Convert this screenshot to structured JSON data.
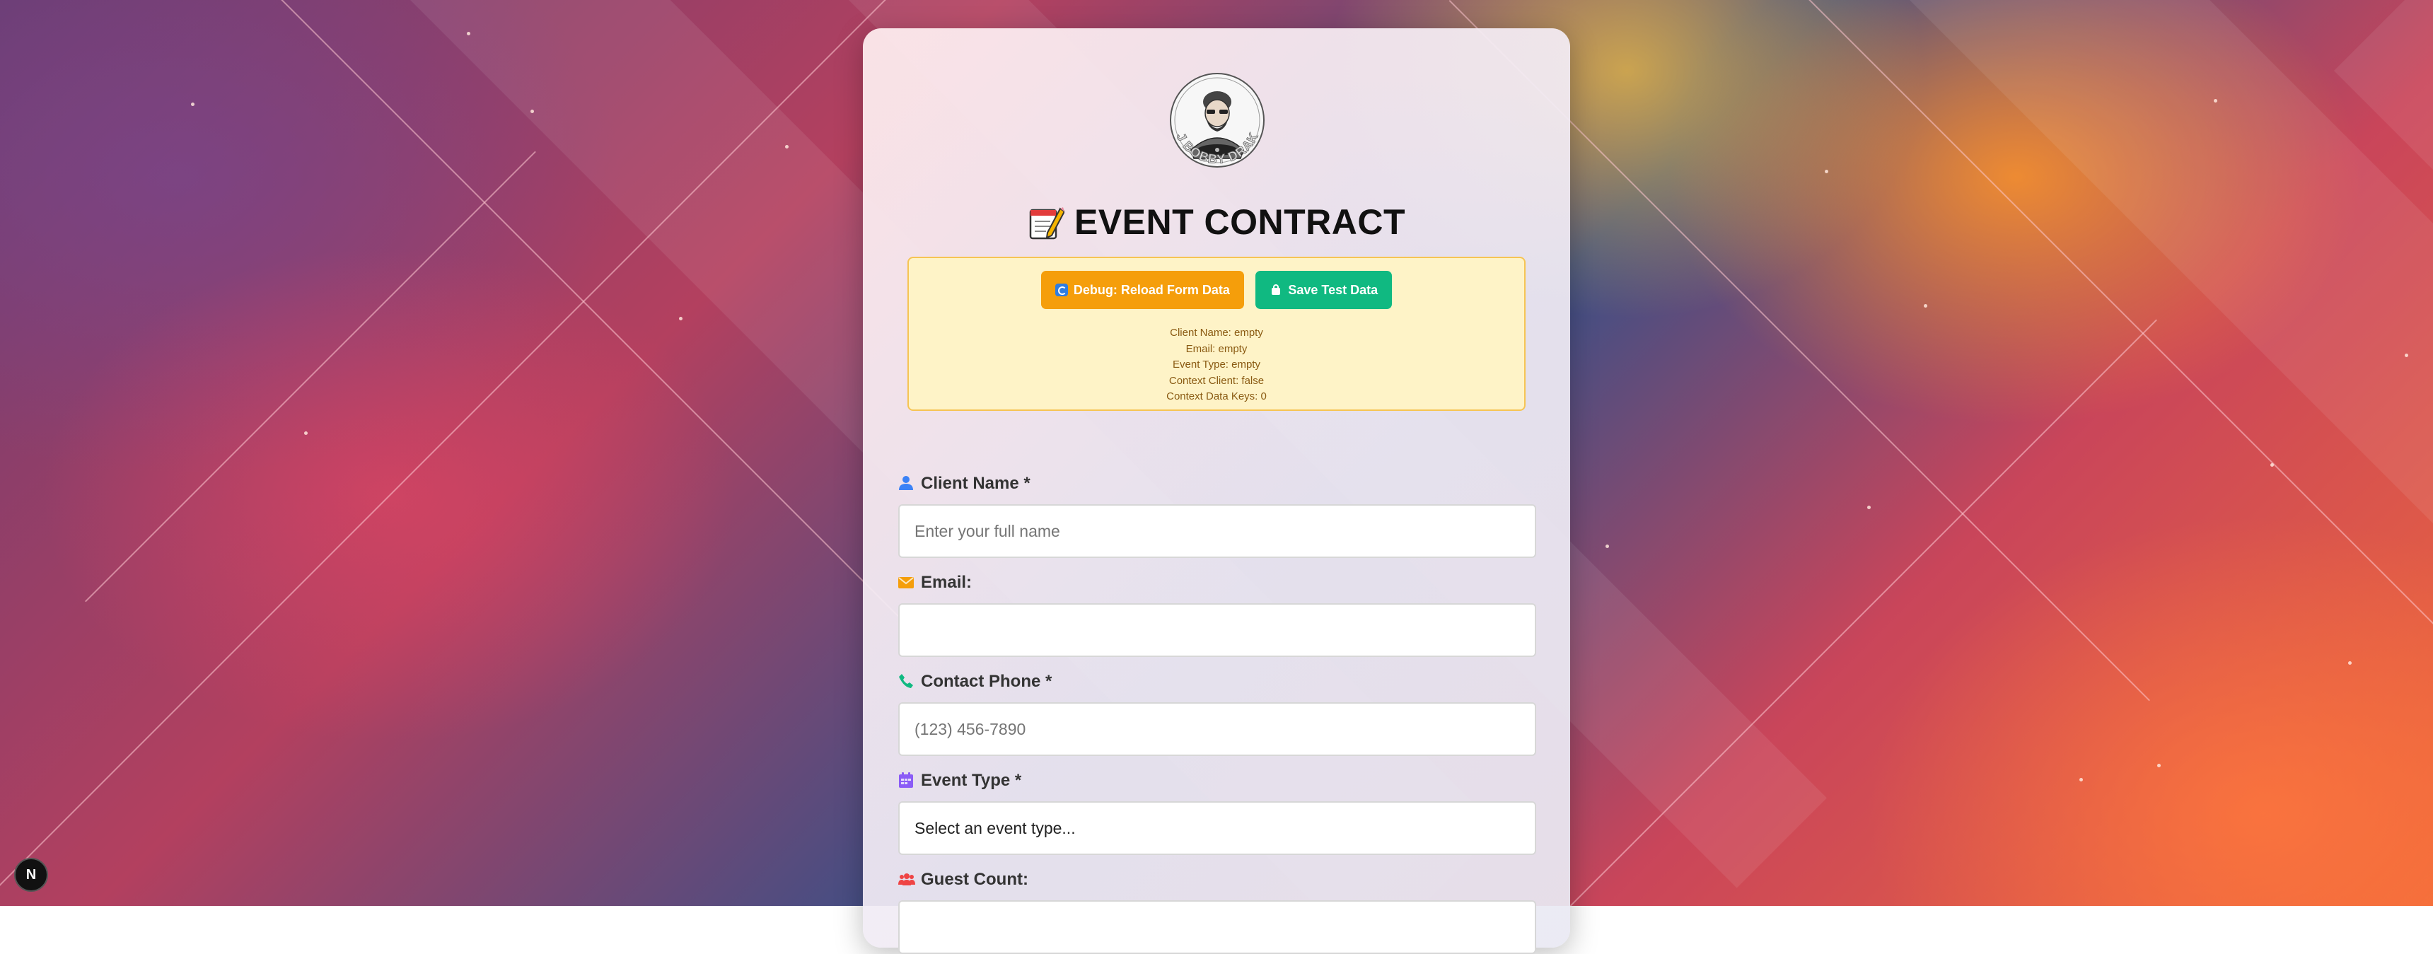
{
  "logo": {
    "text": "DJ BOBBY DRAKE"
  },
  "header": {
    "icon": "memo-icon",
    "title": "EVENT CONTRACT"
  },
  "debug": {
    "reload_label": "Debug: Reload Form Data",
    "save_label": "Save Test Data",
    "lines": [
      "Client Name: empty",
      "Email: empty",
      "Event Type: empty",
      "Context Client: false",
      "Context Data Keys: 0"
    ]
  },
  "fields": {
    "client_name": {
      "label": "Client Name *",
      "placeholder": "Enter your full name",
      "value": "",
      "icon": "user-icon"
    },
    "email": {
      "label": "Email:",
      "placeholder": "",
      "value": "",
      "icon": "envelope-icon"
    },
    "contact_phone": {
      "label": "Contact Phone *",
      "placeholder": "(123) 456-7890",
      "value": "",
      "icon": "phone-icon"
    },
    "event_type": {
      "label": "Event Type *",
      "selected": "Select an event type...",
      "icon": "calendar-icon"
    },
    "guest_count": {
      "label": "Guest Count:",
      "icon": "users-icon"
    }
  },
  "dev_badge": {
    "label": "N"
  },
  "colors": {
    "accent_orange": "#f59e0b",
    "accent_green": "#10b981",
    "debug_bg": "#fef3c7",
    "user_icon": "#3b82f6",
    "envelope_icon": "#f59e0b",
    "phone_icon": "#10b981",
    "calendar_icon": "#8b5cf6",
    "users_icon": "#ef4444"
  }
}
